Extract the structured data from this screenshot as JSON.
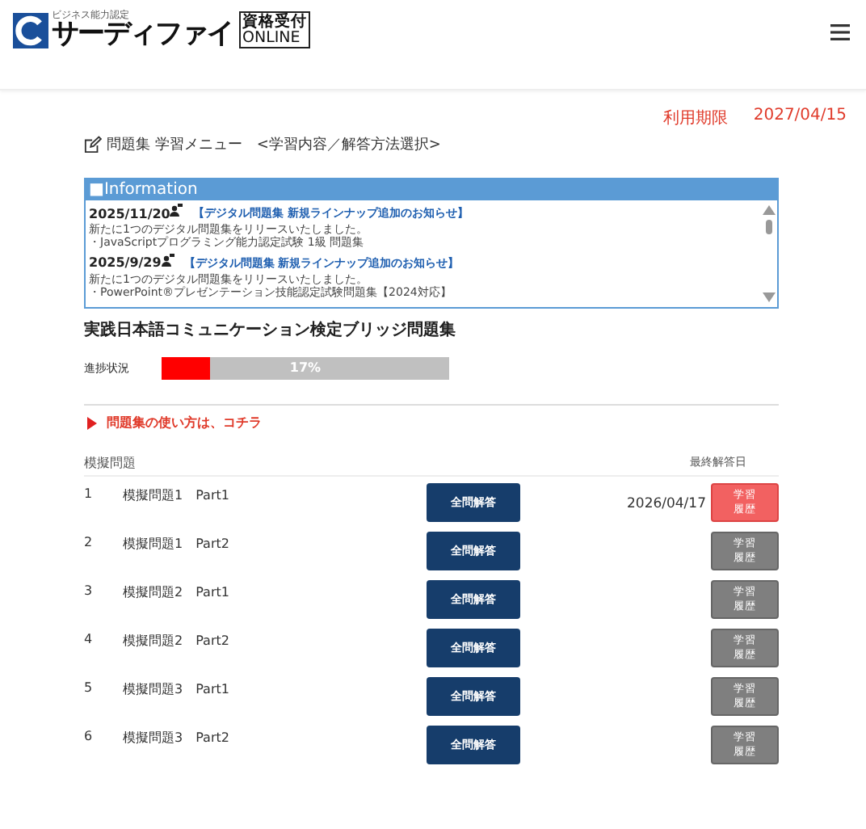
{
  "header": {
    "logo": {
      "tagline": "ビジネス能力認定",
      "brand": "サーディファイ",
      "badge_top": "資格受付",
      "badge_bottom": "ONLINE"
    }
  },
  "expiry": {
    "label": "利用期限",
    "date": "2027/04/15"
  },
  "breadcrumb": "問題集 学習メニュー　<学習内容／解答方法選択>",
  "information": {
    "title": "■Information",
    "items": [
      {
        "date": "2025/11/20",
        "headline": "【デジタル問題集 新規ラインナップ追加のお知らせ】",
        "lines": [
          "新たに1つのデジタル問題集をリリースいたしました。",
          "・JavaScriptプログラミング能力認定試験 1級 問題集"
        ]
      },
      {
        "date": "2025/9/29",
        "headline": "【デジタル問題集 新規ラインナップ追加のお知らせ】",
        "lines": [
          "新たに1つのデジタル問題集をリリースいたしました。",
          "・PowerPoint®プレゼンテーション技能認定試験問題集【2024対応】"
        ]
      }
    ]
  },
  "book_title": "実践日本語コミュニケーション検定ブリッジ問題集",
  "progress": {
    "label": "進捗状況",
    "level": 0.17,
    "reading": "17%"
  },
  "help_link": "問題集の使い方は、コチラ",
  "table": {
    "columns": [
      "模擬問題",
      "最終解答日"
    ],
    "rows": [
      {
        "number": "1",
        "name": "模擬問題1　Part1",
        "button": "全問解答",
        "last_answered": "2026/04/17",
        "history": "学習履歴",
        "has_history": true
      },
      {
        "number": "2",
        "name": "模擬問題1　Part2",
        "button": "全問解答",
        "history": "学習履歴",
        "has_history": false
      },
      {
        "number": "3",
        "name": "模擬問題2　Part1",
        "button": "全問解答",
        "history": "学習履歴",
        "has_history": false
      },
      {
        "number": "4",
        "name": "模擬問題2　Part2",
        "button": "全問解答",
        "history": "学習履歴",
        "has_history": false
      },
      {
        "number": "5",
        "name": "模擬問題3　Part1",
        "button": "全問解答",
        "history": "学習履歴",
        "has_history": false
      },
      {
        "number": "6",
        "name": "模擬問題3　Part2",
        "button": "全問解答",
        "history": "学習履歴",
        "has_history": false
      }
    ]
  }
}
